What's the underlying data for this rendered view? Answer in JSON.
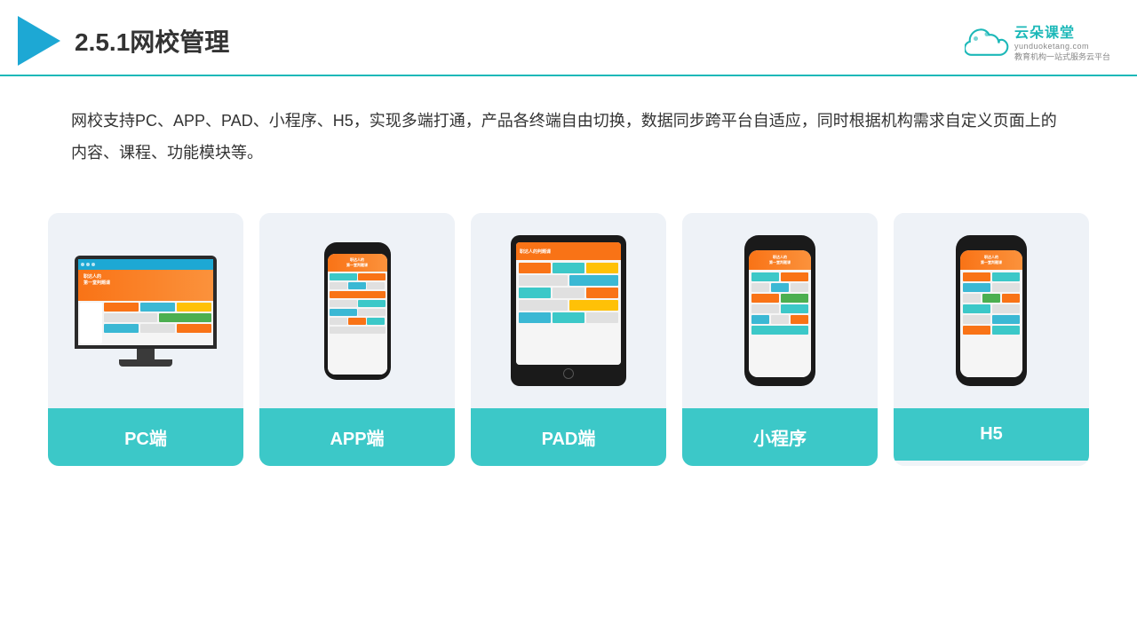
{
  "header": {
    "title": "2.5.1网校管理",
    "logo_main": "云朵课堂",
    "logo_sub": "yunduoketang.com",
    "logo_tagline": "教育机构一站式服务云平台"
  },
  "description": {
    "text": "网校支持PC、APP、PAD、小程序、H5，实现多端打通，产品各终端自由切换，数据同步跨平台自适应，同时根据机构需求自定义页面上的内容、课程、功能模块等。"
  },
  "cards": [
    {
      "id": "pc",
      "label": "PC端"
    },
    {
      "id": "app",
      "label": "APP端"
    },
    {
      "id": "pad",
      "label": "PAD端"
    },
    {
      "id": "miniprogram",
      "label": "小程序"
    },
    {
      "id": "h5",
      "label": "H5"
    }
  ],
  "colors": {
    "teal": "#3cc8c8",
    "accent_blue": "#1da8d4",
    "border": "#1cb8b8"
  }
}
